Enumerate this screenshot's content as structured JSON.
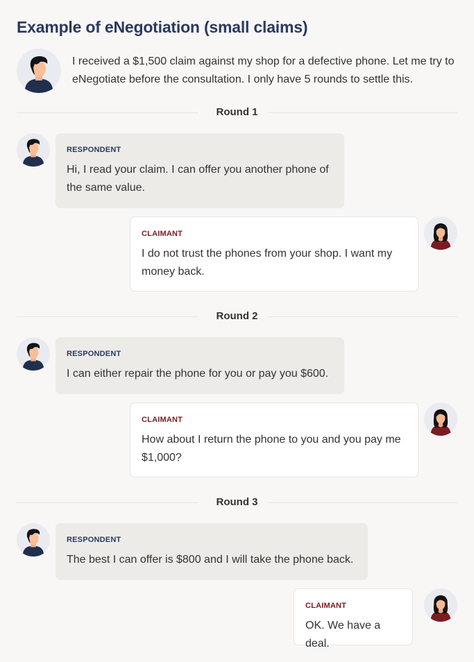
{
  "title": "Example of eNegotiation (small claims)",
  "intro": "I received a $1,500 claim against my shop for a defective phone. Let me try to eNegotiate before the consultation. I only have 5 rounds to settle this.",
  "roles": {
    "respondent": "RESPONDENT",
    "claimant": "CLAIMANT"
  },
  "rounds": [
    {
      "label": "Round 1",
      "respondent": "Hi, I read your claim. I can offer you another phone of the same value.",
      "claimant": "I do not trust the phones from your shop. I want my money back."
    },
    {
      "label": "Round 2",
      "respondent": "I can either repair the phone for you or pay you $600.",
      "claimant": "How about I return the phone to you and you pay me $1,000?"
    },
    {
      "label": "Round 3",
      "respondent": "The best I can offer is $800 and I will take the phone back.",
      "claimant": "OK. We have a deal."
    }
  ],
  "colors": {
    "title": "#2a3a5e",
    "respondent_label": "#2a3a5e",
    "claimant_label": "#7a1d22",
    "respondent_bubble": "#ecebe8",
    "claimant_bubble": "#ffffff"
  }
}
